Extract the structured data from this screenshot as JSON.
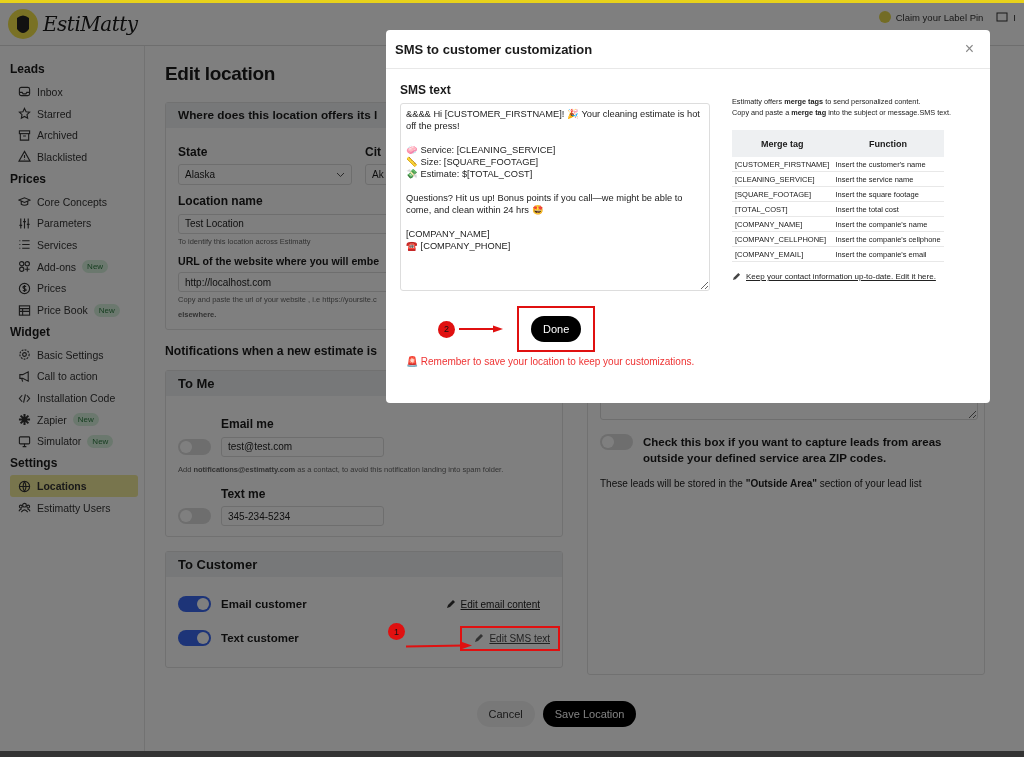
{
  "header": {
    "logo_text": "EstiMatty",
    "links": [
      {
        "label": "Claim your Label Pin"
      },
      {
        "label": "I"
      }
    ]
  },
  "sidebar": [
    {
      "heading": "Leads",
      "items": [
        {
          "label": "Inbox",
          "selected": false
        },
        {
          "label": "Starred",
          "selected": false
        },
        {
          "label": "Archived",
          "selected": false
        },
        {
          "label": "Blacklisted",
          "selected": false
        }
      ]
    },
    {
      "heading": "Prices",
      "items": [
        {
          "label": "Core Concepts",
          "selected": false
        },
        {
          "label": "Parameters",
          "selected": false
        },
        {
          "label": "Services",
          "selected": false
        },
        {
          "label": "Add-ons",
          "badge": "New",
          "selected": false
        },
        {
          "label": "Prices",
          "selected": false
        },
        {
          "label": "Price Book",
          "badge": "New",
          "selected": false
        }
      ]
    },
    {
      "heading": "Widget",
      "items": [
        {
          "label": "Basic Settings",
          "selected": false
        },
        {
          "label": "Call to action",
          "selected": false
        },
        {
          "label": "Installation Code",
          "selected": false
        },
        {
          "label": "Zapier",
          "badge": "New",
          "selected": false
        },
        {
          "label": "Simulator",
          "badge": "New",
          "selected": false
        }
      ]
    },
    {
      "heading": "Settings",
      "items": [
        {
          "label": "Locations",
          "selected": true
        },
        {
          "label": "Estimatty Users",
          "selected": false
        }
      ]
    }
  ],
  "page_title": "Edit location",
  "area_card": {
    "title": "Where does this location offers its l",
    "state_label": "State",
    "state_value": "Alaska",
    "city_label": "Cit",
    "city_value": "Ak",
    "name_label": "Location name",
    "name_value": "Test Location",
    "name_hint": "To identify this location across Estimatty",
    "url_label": "URL of the website where you will embe",
    "url_value": "http://localhost.com",
    "url_hint": "Copy and paste the url of your website , i.e https://yoursite.c",
    "url_hint_2": "elsewhere."
  },
  "notifications_title": "Notifications when a new estimate is",
  "to_me": {
    "title": "To Me",
    "rows": [
      {
        "label": "Email me",
        "value": "test@test.com",
        "on": false
      },
      {
        "label": "Text me",
        "value": "345-234-5234",
        "on": false
      }
    ],
    "hint": "Add **notifications@estimatty.com** as a contact, to avoid this notification landing into spam folder."
  },
  "to_customer": {
    "title": "To Customer",
    "rows": [
      {
        "label": "Email customer",
        "on": true,
        "link": "Edit email content",
        "annotated": false
      },
      {
        "label": "Text customer",
        "on": true,
        "link": "Edit SMS text",
        "annotated": true
      }
    ]
  },
  "outside_area": {
    "on": false,
    "label": "Check this box if you want to capture leads from areas outside your defined service area ZIP codes.",
    "note": "These leads will be stored in the **\"Outside Area\"** section of your lead list"
  },
  "footer_buttons": [
    {
      "label": "Cancel",
      "kind": "secondary"
    },
    {
      "label": "Save Location",
      "kind": "primary"
    }
  ],
  "modal": {
    "title": "SMS to customer customization",
    "close": "×",
    "sms_label": "SMS text",
    "sms_value": "&&&& Hi [CUSTOMER_FIRSTNAME]! 🎉 Your cleaning estimate is hot off the press!\n\n🧼 Service: [CLEANING_SERVICE]\n📏 Size: [SQUARE_FOOTAGE]\n💸 Estimate: $[TOTAL_COST]\n\nQuestions? Hit us up! Bonus points if you call—we might be able to come, and clean within 24 hrs 🤩\n\n[COMPANY_NAME]\n☎️ [COMPANY_PHONE]",
    "done": "Done",
    "reminder": "🚨 Remember to save your location to keep your customizations.",
    "intro": "Estimatty offers **merge tags** to send personalized content.\nCopy and paste a **merge tag** into the subject or message.SMS text.",
    "table": {
      "columns": [
        "Merge tag",
        "Function"
      ],
      "rows": [
        [
          "[CUSTOMER_FIRSTNAME]",
          "Insert the customer's name"
        ],
        [
          "[CLEANING_SERVICE]",
          "Insert the service name"
        ],
        [
          "[SQUARE_FOOTAGE]",
          "Insert the square footage"
        ],
        [
          "[TOTAL_COST]",
          "Insert the total cost"
        ],
        [
          "[COMPANY_NAME]",
          "Insert the companie's name"
        ],
        [
          "[COMPANY_CELLPHONE]",
          "Insert the companie's cellphone"
        ],
        [
          "[COMPANY_EMAIL]",
          "Insert the companie's email"
        ]
      ]
    },
    "contact_link": "Keep your contact information up-to-date. Edit it here."
  },
  "annotations": [
    {
      "label": "1"
    },
    {
      "label": "2"
    }
  ]
}
